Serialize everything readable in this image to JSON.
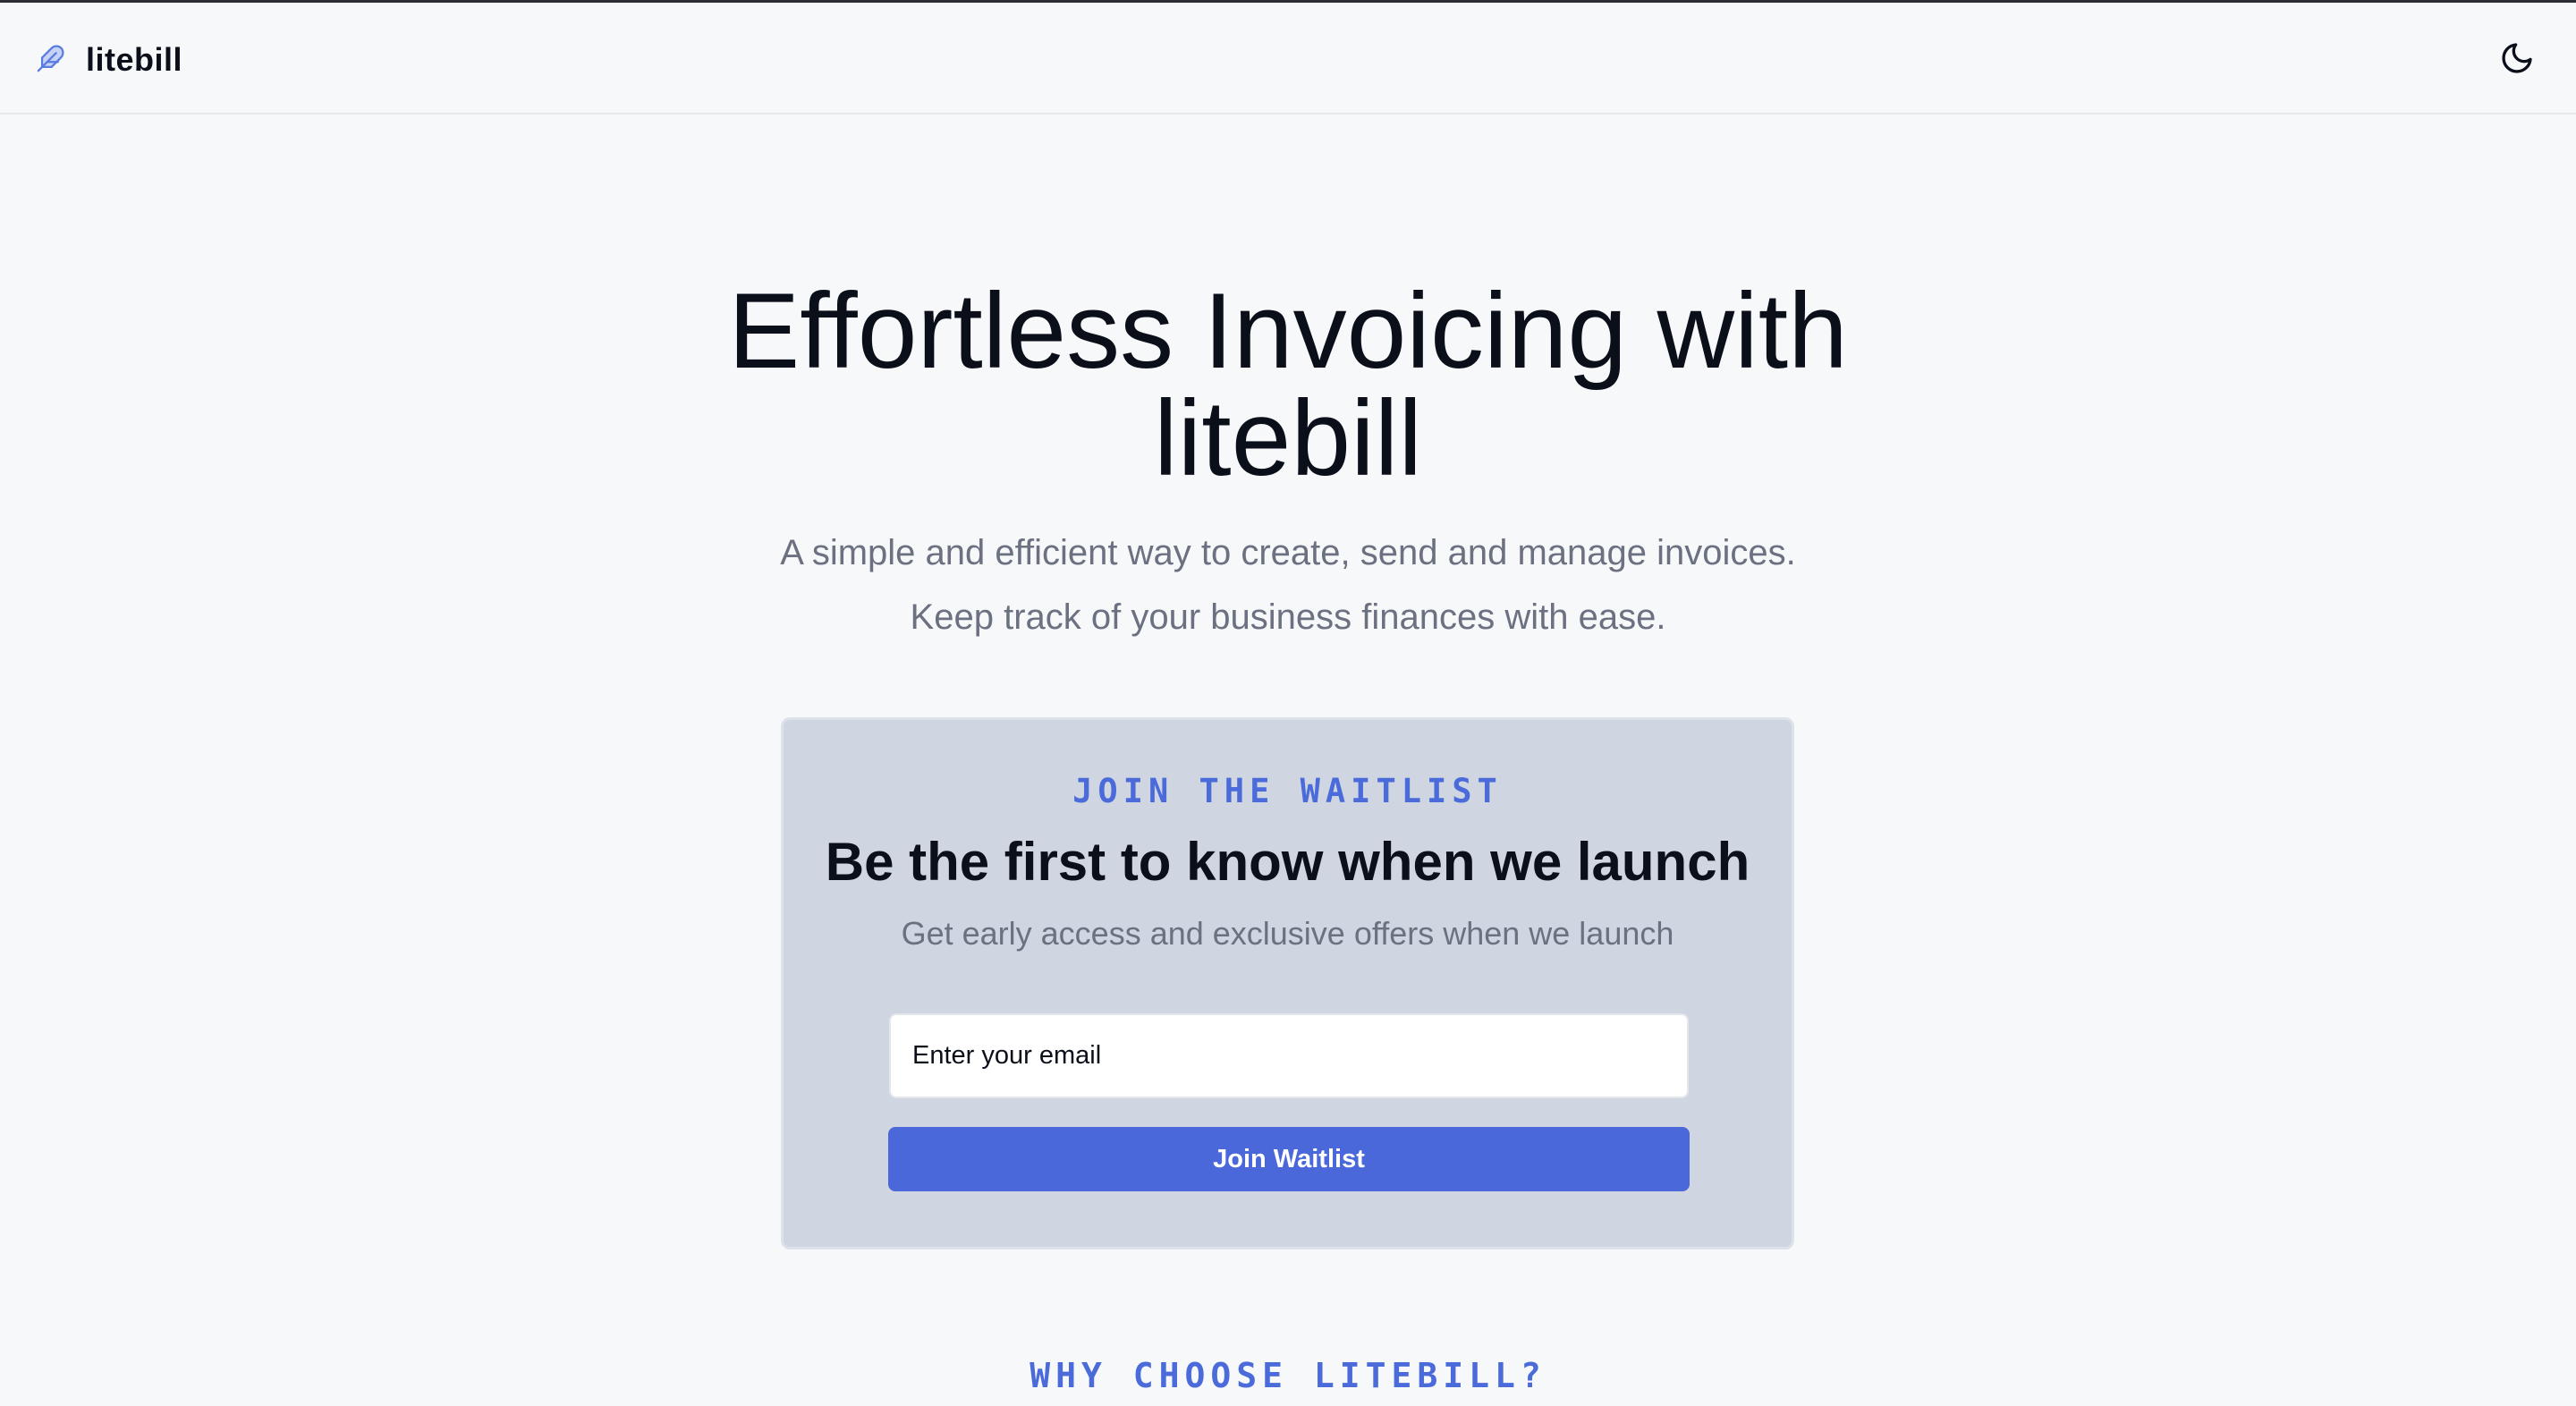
{
  "header": {
    "brand_name": "litebill",
    "logo_icon": "feather-icon",
    "theme_toggle_icon": "moon-icon"
  },
  "hero": {
    "title": "Effortless Invoicing with litebill",
    "subtitle_line1": "A simple and efficient way to create, send and manage invoices.",
    "subtitle_line2": "Keep track of your business finances with ease."
  },
  "waitlist": {
    "eyebrow": "JOIN THE WAITLIST",
    "title": "Be the first to know when we launch",
    "subtitle": "Get early access and exclusive offers when we launch",
    "email_placeholder": "Enter your email",
    "button_label": "Join Waitlist"
  },
  "section": {
    "why_title": "WHY CHOOSE LITEBILL?"
  },
  "colors": {
    "accent": "#4a68d9",
    "background": "#f7f8fa",
    "card": "#cfd6e1",
    "muted_text": "#6b7180"
  }
}
